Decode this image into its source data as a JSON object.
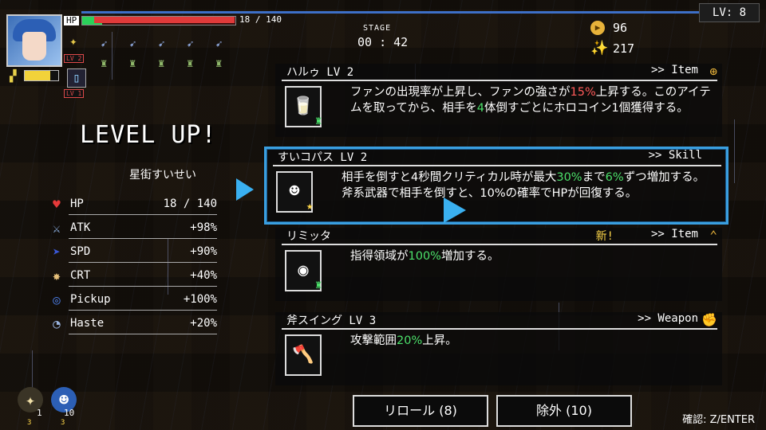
{
  "hud": {
    "hp_label": "HP",
    "hp_text": "18 / 140",
    "hp_fraction": 0.13,
    "special_fraction": 0.75,
    "level": "LV: 8",
    "stage_label": "STAGE",
    "timer": "00 : 42",
    "coins": "96",
    "holo_points": "217",
    "weapon_level_badge": "LV 2",
    "item_level_badge": "LV 1"
  },
  "levelup": {
    "title": "LEVEL UP!",
    "character": "星街すいせい",
    "stats": [
      {
        "icon": "heart-icon",
        "glyph": "♥",
        "color": "#e53a3a",
        "label": "HP",
        "value": "18 / 140"
      },
      {
        "icon": "sword-icon",
        "glyph": "⚔",
        "color": "#8fb3e6",
        "label": "ATK",
        "value": "+98%"
      },
      {
        "icon": "boot-icon",
        "glyph": "➤",
        "color": "#3a58d8",
        "label": "SPD",
        "value": "+90%"
      },
      {
        "icon": "crit-icon",
        "glyph": "✸",
        "color": "#e7c07a",
        "label": "CRT",
        "value": "+40%"
      },
      {
        "icon": "pickup-icon",
        "glyph": "◎",
        "color": "#4a7ae0",
        "label": "Pickup",
        "value": "+100%"
      },
      {
        "icon": "haste-icon",
        "glyph": "◔",
        "color": "#9ab4e0",
        "label": "Haste",
        "value": "+20%"
      }
    ]
  },
  "options": [
    {
      "title": "ハルゥ LV 2",
      "kind": ">> Item",
      "kind_icon": "crosshair-icon",
      "kind_glyph": "⊕",
      "new": "",
      "icon": "cup-icon",
      "glyph": "🥛",
      "desc_parts": [
        "ファンの出現率が上昇し、ファンの強さが",
        "15%",
        "上昇する。このアイテムを取ってから、相手を",
        "4",
        "体倒すごとにホロコイン1個獲得する。"
      ]
    },
    {
      "title": "すいコパス LV 2",
      "kind": ">> Skill",
      "kind_icon": "",
      "kind_glyph": "",
      "new": "",
      "icon": "suisei-portrait-icon",
      "glyph": "☻",
      "desc_parts": [
        "相手を倒すと4秒間クリティカル時が最大",
        "30%",
        "まで",
        "6%",
        "ずつ増加する。斧系武器で相手を倒すと、10%の確率でHPが",
        "",
        "回復する。"
      ]
    },
    {
      "title": "リミッタ",
      "kind": ">> Item",
      "kind_icon": "chevron-up-icon",
      "kind_glyph": "⌃",
      "new": "新!",
      "icon": "limiter-icon",
      "glyph": "◉",
      "desc_parts": [
        "指得領域が",
        "100%",
        "増加する。"
      ]
    },
    {
      "title": "斧スイング LV 3",
      "kind": ">> Weapon",
      "kind_icon": "fist-icon",
      "kind_glyph": "✊",
      "new": "",
      "icon": "axe-icon",
      "glyph": "🪓",
      "desc_parts": [
        "攻撃範囲",
        "20%",
        "上昇。"
      ]
    }
  ],
  "buttons": {
    "reroll": "リロール (8)",
    "eliminate": "除外 (10)",
    "confirm": "確認: Z/ENTER"
  },
  "bottom": {
    "compass_count": "1",
    "compass_lv": "3",
    "fan_count": "10",
    "fan_lv": "3"
  }
}
